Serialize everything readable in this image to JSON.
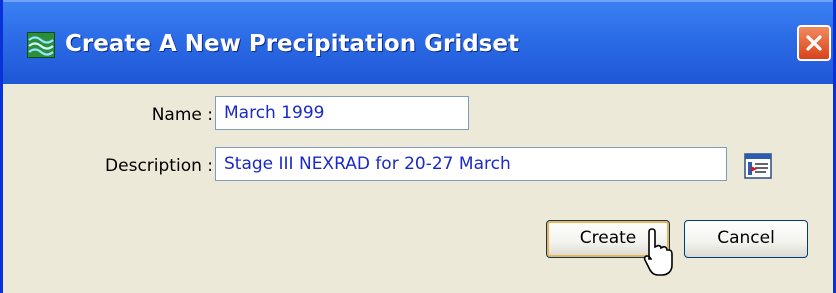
{
  "window": {
    "title": "Create A New Precipitation Gridset",
    "title_icon": "gridset-app-icon",
    "close_icon": "close-icon"
  },
  "form": {
    "name_label": "Name :",
    "name_value": "March 1999",
    "description_label": "Description :",
    "description_value": "Stage III NEXRAD for 20-27 March",
    "description_editor_icon": "text-editor-icon"
  },
  "buttons": {
    "create_label": "Create",
    "cancel_label": "Cancel"
  },
  "colors": {
    "titlebar": "#2c6be6",
    "dialog_background": "#ece9d8",
    "field_text": "#1a29c8",
    "close_button": "#e0562c"
  }
}
